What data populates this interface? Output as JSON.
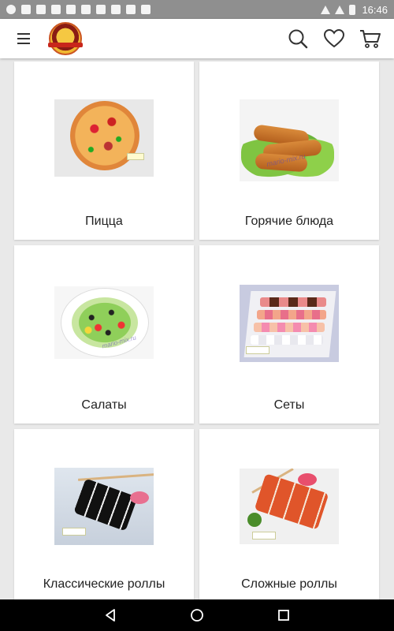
{
  "status_bar": {
    "time": "16:46"
  },
  "app_bar": {
    "logo_text": "МАРИО-МИКС ДОСТАВКА ЕДЫ",
    "icons": [
      "menu-icon",
      "search-icon",
      "heart-icon",
      "cart-icon"
    ]
  },
  "categories": [
    {
      "label": "Пицца",
      "image": "pizza"
    },
    {
      "label": "Горячие блюда",
      "image": "hot-dishes",
      "watermark": "mario-mix.ru"
    },
    {
      "label": "Салаты",
      "image": "salad",
      "watermark": "mario-mix.ru"
    },
    {
      "label": "Сеты",
      "image": "sushi-sets"
    },
    {
      "label": "Классические роллы",
      "image": "classic-rolls"
    },
    {
      "label": "Сложные роллы",
      "image": "complex-rolls"
    }
  ],
  "navigation": {
    "icons": [
      "back-icon",
      "home-icon",
      "recents-icon"
    ]
  },
  "colors": {
    "status_bar": "#8f8f8f",
    "app_bar": "#ffffff",
    "background": "#e9e9e9",
    "nav_bar": "#000000"
  }
}
